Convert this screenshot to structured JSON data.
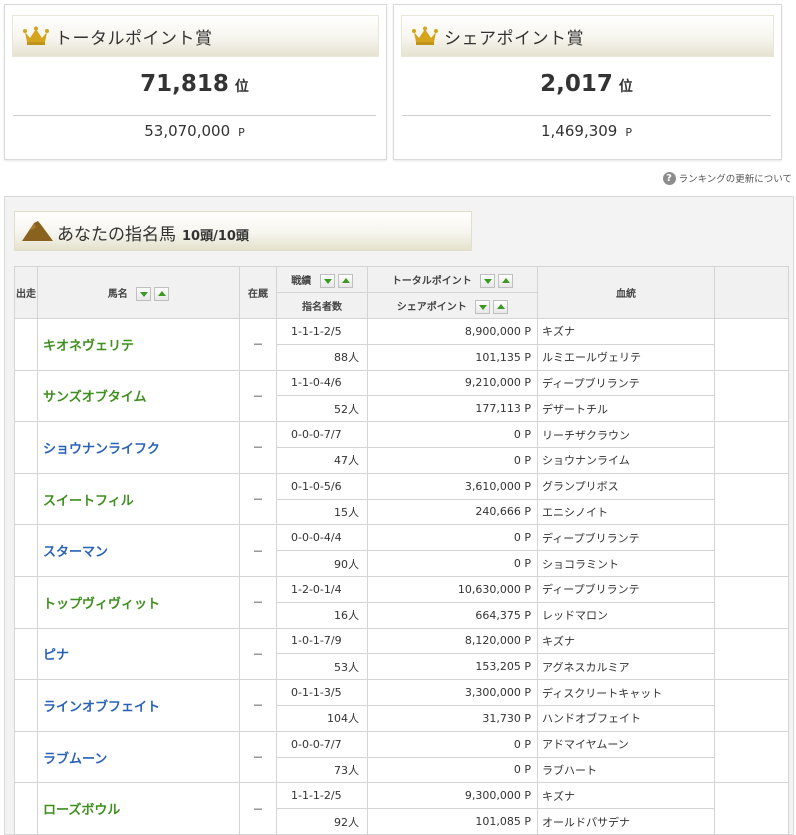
{
  "awards": {
    "total": {
      "title": "トータルポイント賞",
      "rank": "71,818",
      "rank_unit": "位",
      "points": "53,070,000",
      "points_unit": "P"
    },
    "share": {
      "title": "シェアポイント賞",
      "rank": "2,017",
      "rank_unit": "位",
      "points": "1,469,309",
      "points_unit": "P"
    }
  },
  "update_link": "ランキングの更新について",
  "panel": {
    "title": "あなたの指名馬",
    "count": "10頭/10頭"
  },
  "table_headers": {
    "start": "出走",
    "name": "馬名",
    "status": "在厩",
    "record": "戦績",
    "nominators": "指名者数",
    "total_points": "トータルポイント",
    "share_points": "シェアポイント",
    "pedigree": "血統"
  },
  "colors": {
    "name_green": "#3f8f1e",
    "name_blue": "#2a62b8",
    "crown": "#d4a51c",
    "horse_icon": "#8a6220"
  },
  "horses": [
    {
      "name": "キオネヴェリテ",
      "name_color": "green",
      "status": "－",
      "record": "1-1-1-2/5",
      "nominators": "88人",
      "total_points": "8,900,000 P",
      "share_points": "101,135 P",
      "sire": "キズナ",
      "dam": "ルミエールヴェリテ"
    },
    {
      "name": "サンズオブタイム",
      "name_color": "green",
      "status": "－",
      "record": "1-1-0-4/6",
      "nominators": "52人",
      "total_points": "9,210,000 P",
      "share_points": "177,113 P",
      "sire": "ディープブリランテ",
      "dam": "デザートチル"
    },
    {
      "name": "ショウナンライフク",
      "name_color": "blue",
      "status": "－",
      "record": "0-0-0-7/7",
      "nominators": "47人",
      "total_points": "0 P",
      "share_points": "0 P",
      "sire": "リーチザクラウン",
      "dam": "ショウナンライム"
    },
    {
      "name": "スイートフィル",
      "name_color": "green",
      "status": "－",
      "record": "0-1-0-5/6",
      "nominators": "15人",
      "total_points": "3,610,000 P",
      "share_points": "240,666 P",
      "sire": "グランプリボス",
      "dam": "エニシノイト"
    },
    {
      "name": "スターマン",
      "name_color": "blue",
      "status": "－",
      "record": "0-0-0-4/4",
      "nominators": "90人",
      "total_points": "0 P",
      "share_points": "0 P",
      "sire": "ディープブリランテ",
      "dam": "ショコラミント"
    },
    {
      "name": "トップヴィヴィット",
      "name_color": "green",
      "status": "－",
      "record": "1-2-0-1/4",
      "nominators": "16人",
      "total_points": "10,630,000 P",
      "share_points": "664,375 P",
      "sire": "ディープブリランテ",
      "dam": "レッドマロン"
    },
    {
      "name": "ピナ",
      "name_color": "blue",
      "status": "－",
      "record": "1-0-1-7/9",
      "nominators": "53人",
      "total_points": "8,120,000 P",
      "share_points": "153,205 P",
      "sire": "キズナ",
      "dam": "アグネスカルミア"
    },
    {
      "name": "ラインオブフェイト",
      "name_color": "blue",
      "status": "－",
      "record": "0-1-1-3/5",
      "nominators": "104人",
      "total_points": "3,300,000 P",
      "share_points": "31,730 P",
      "sire": "ディスクリートキャット",
      "dam": "ハンドオブフェイト"
    },
    {
      "name": "ラブムーン",
      "name_color": "blue",
      "status": "－",
      "record": "0-0-0-7/7",
      "nominators": "73人",
      "total_points": "0 P",
      "share_points": "0 P",
      "sire": "アドマイヤムーン",
      "dam": "ラブハート"
    },
    {
      "name": "ローズボウル",
      "name_color": "green",
      "status": "－",
      "record": "1-1-1-2/5",
      "nominators": "92人",
      "total_points": "9,300,000 P",
      "share_points": "101,085 P",
      "sire": "キズナ",
      "dam": "オールドパサデナ"
    }
  ]
}
